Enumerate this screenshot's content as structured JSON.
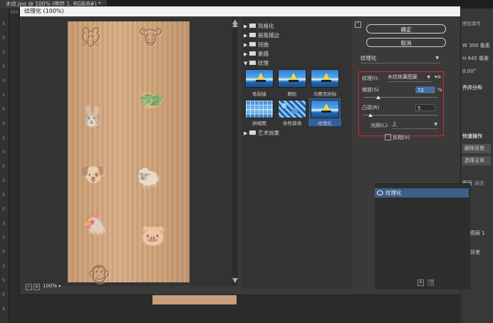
{
  "ps": {
    "tab_title": "木纹.jpg @ 100% (图层 1, RGB/8#) *",
    "ruler_marks": [
      "5",
      "0",
      "1",
      "0",
      "0",
      "1",
      "5",
      "0",
      "2",
      "0",
      "0",
      "2",
      "5",
      "0",
      "3",
      "0",
      "0",
      "3",
      "5",
      "0",
      "4"
    ],
    "ruler_top_label": "350",
    "right_panel": {
      "title": "图层属性",
      "w_label": "W",
      "w_value": "300 像素",
      "h_label": "H",
      "h_value": "645 像素",
      "angle_value": "0.00°",
      "section_align": "齐并分布",
      "section_ops": "快速操作",
      "btn_remove_bg": "删除背景",
      "btn_select_subject": "选择主体",
      "tab_layers": "图层",
      "tab_channels": "通道",
      "layer1": "图层 1",
      "layer_bg": "背景"
    }
  },
  "dialog": {
    "title": "纹理化 (100%)",
    "zoom": "100%",
    "ok_label": "确定",
    "cancel_label": "取消",
    "categories": [
      {
        "label": "风格化",
        "expanded": false
      },
      {
        "label": "画笔描边",
        "expanded": false
      },
      {
        "label": "扭曲",
        "expanded": false
      },
      {
        "label": "素描",
        "expanded": false
      },
      {
        "label": "纹理",
        "expanded": true
      },
      {
        "label": "艺术效果",
        "expanded": false
      }
    ],
    "thumbs": [
      {
        "label": "龟裂缝",
        "style": "sea"
      },
      {
        "label": "颗粒",
        "style": "sea"
      },
      {
        "label": "马赛克拼贴",
        "style": "sea"
      },
      {
        "label": "拼缀图",
        "style": "grid"
      },
      {
        "label": "染色玻璃",
        "style": "glass"
      },
      {
        "label": "纹理化",
        "style": "sea",
        "selected": true
      }
    ],
    "filter_select": "纹理化",
    "options": {
      "texture_label": "纹理(I):",
      "texture_value": "木纹效果图案",
      "scale_label": "缩放(S)",
      "scale_value": "72",
      "scale_unit": "%",
      "scale_pct": 0.2,
      "relief_label": "凸现(R)",
      "relief_value": "5",
      "relief_pct": 0.1,
      "light_label": "光照(L):",
      "light_value": "上",
      "invert_label": "反相(V)"
    },
    "effect_layer": "纹理化"
  }
}
